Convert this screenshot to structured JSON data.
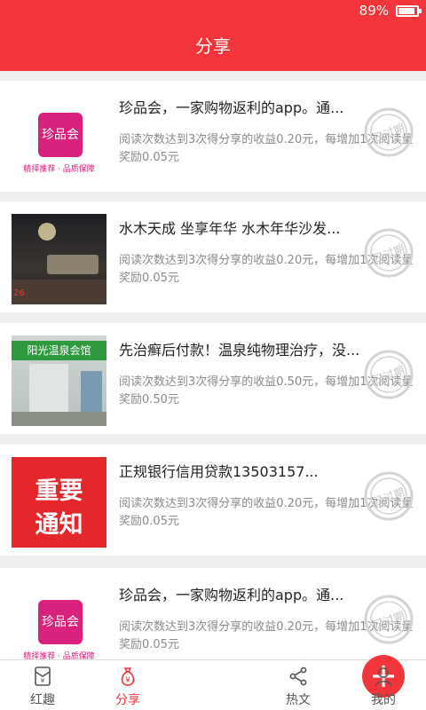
{
  "status_bar": {
    "battery_text": "89%",
    "battery_level": 0.89
  },
  "header": {
    "title": "分享"
  },
  "cards": [
    {
      "title": "珍品会，一家购物返利的app。通...",
      "desc": "阅读次数达到3次得分享的收益0.20元，每增加1次阅读量奖励0.05元",
      "thumb_logo_text": "珍品会",
      "thumb_caption": "精择推荐 · 品质保障",
      "stamp_text": "已过期"
    },
    {
      "title": "水木天成 坐享年华 水木年华沙发...",
      "desc": "阅读次数达到3次得分享的收益0.20元，每增加1次阅读量奖励0.05元",
      "thumb_corner_text": "26",
      "stamp_text": "已过期"
    },
    {
      "title": "先治癣后付款！温泉纯物理治疗，没...",
      "desc": "阅读次数达到3次得分享的收益0.50元，每增加1次阅读量奖励0.50元",
      "thumb_sign_text": "阳光温泉会馆",
      "stamp_text": "已过期"
    },
    {
      "title": "正规银行信用贷款13503157...",
      "desc": "阅读次数达到3次得分享的收益0.20元，每增加1次阅读量奖励0.05元",
      "thumb_text_line1": "重要",
      "thumb_text_line2": "通知",
      "stamp_text": "已过期"
    },
    {
      "title": "珍品会，一家购物返利的app。通...",
      "desc": "阅读次数达到3次得分享的收益0.20元，每增加1次阅读量奖励0.05元",
      "thumb_logo_text": "珍品会",
      "thumb_caption": "精择推荐 · 品质保障",
      "stamp_text": "已过期"
    }
  ],
  "tabs": [
    {
      "label": "红趣",
      "icon": "red-envelope-icon"
    },
    {
      "label": "分享",
      "icon": "money-bag-icon"
    },
    {
      "label": "",
      "icon": "plus-icon"
    },
    {
      "label": "热文",
      "icon": "share-nodes-icon"
    },
    {
      "label": "我的",
      "icon": "user-icon"
    }
  ],
  "colors": {
    "brand": "#f2353a",
    "logo_magenta": "#d8227d",
    "text_gray": "#8a8a8a"
  }
}
